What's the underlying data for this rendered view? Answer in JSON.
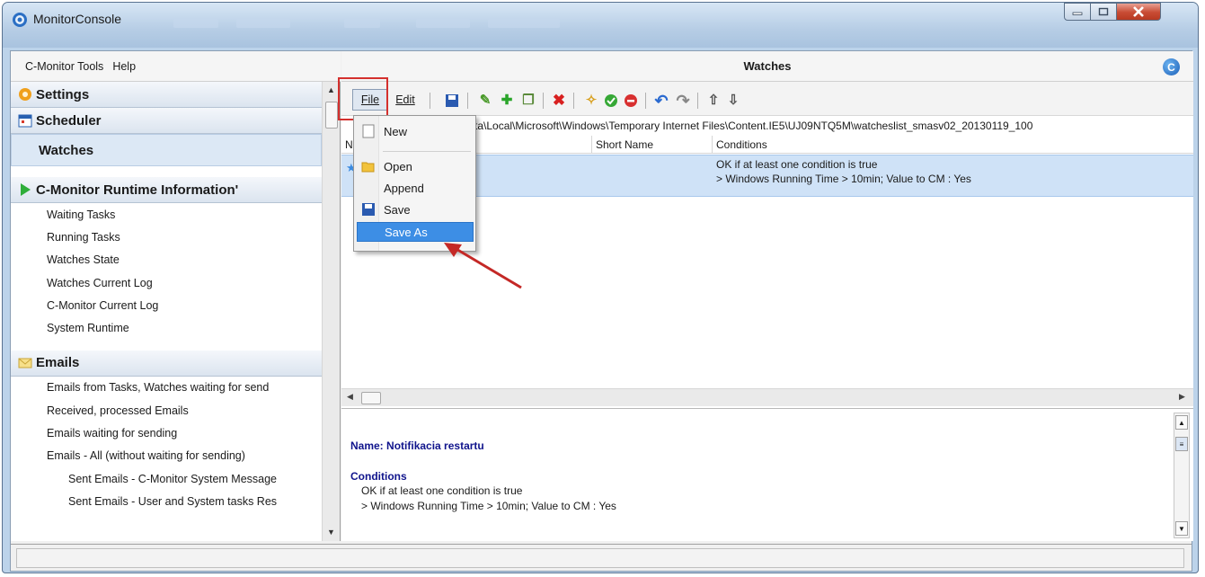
{
  "window": {
    "title": "MonitorConsole"
  },
  "left_panel": {
    "menu": [
      "C-Monitor Tools",
      "Help"
    ],
    "sections": {
      "settings": "Settings",
      "scheduler": "Scheduler",
      "watches": "Watches",
      "runtime": "C-Monitor Runtime Information'",
      "emails": "Emails"
    },
    "runtime_items": [
      "Waiting Tasks",
      "Running Tasks",
      "Watches State",
      "Watches Current Log",
      "C-Monitor Current Log",
      "System Runtime"
    ],
    "email_items": [
      "Emails from Tasks, Watches waiting for send",
      "Received, processed Emails",
      "Emails waiting for sending",
      "Emails - All (without waiting for sending)"
    ],
    "email_subitems": [
      "Sent Emails - C-Monitor System Message",
      "Sent Emails - User and System tasks Res"
    ]
  },
  "right_panel": {
    "title": "Watches",
    "toolbar": {
      "file": "File",
      "edit": "Edit"
    },
    "path": "C:\\Users\\...\\AppData\\Local\\Microsoft\\Windows\\Temporary Internet Files\\Content.IE5\\UJ09NTQ5M\\watcheslist_smasv02_20130119_100",
    "path_visible": "ta\\Local\\Microsoft\\Windows\\Temporary Internet Files\\Content.IE5\\UJ09NTQ5M\\watcheslist_smasv02_20130119_100",
    "columns": {
      "name": "N",
      "short_name": "Short Name",
      "conditions": "Conditions"
    },
    "row": {
      "conditions_line1": "OK if at least one condition is true",
      "conditions_line2": "> Windows Running Time > 10min; Value to CM : Yes"
    },
    "details": {
      "name_label": "Name:",
      "name_value": "Notifikacia restartu",
      "conditions_label": "Conditions",
      "line1": "OK if at least one condition is true",
      "line2": "> Windows Running Time > 10min; Value to CM : Yes"
    }
  },
  "file_menu": {
    "items": [
      "New",
      "Open",
      "Append",
      "Save",
      "Save As"
    ],
    "selected": "Save As"
  },
  "colors": {
    "accent": "#3d8ee5",
    "highlight_box": "#d4302e",
    "selected_row": "#cfe2f7",
    "label_blue": "#10148c"
  }
}
